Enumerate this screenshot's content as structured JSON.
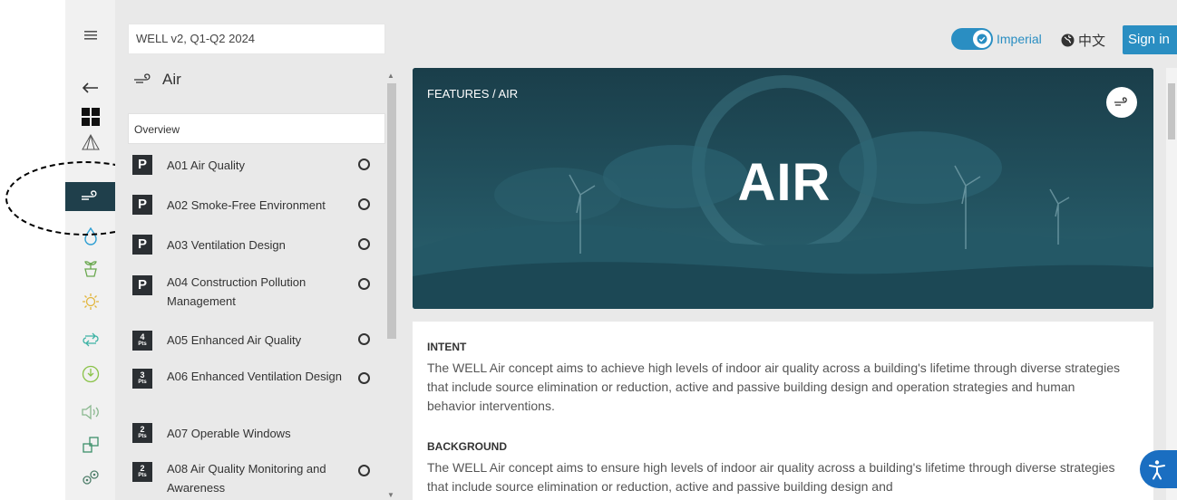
{
  "header": {
    "search_value": "WELL v2, Q1-Q2 2024",
    "units_label": "Imperial",
    "language_label": "中文",
    "sign_in_label": "Sign in"
  },
  "rail": {
    "items": [
      "menu",
      "back",
      "dashboard",
      "concepts",
      "air",
      "water",
      "nourishment",
      "light",
      "movement",
      "thermal-comfort",
      "sound",
      "materials",
      "community"
    ]
  },
  "panel": {
    "title": "Air",
    "overview_label": "Overview",
    "features": [
      {
        "badge": "P",
        "name": "A01 Air Quality"
      },
      {
        "badge": "P",
        "name": "A02 Smoke-Free Environment"
      },
      {
        "badge": "P",
        "name": "A03 Ventilation Design"
      },
      {
        "badge": "P",
        "name": "A04 Construction Pollution Management"
      },
      {
        "badge": "4",
        "badge_unit": "Pts",
        "name": "A05 Enhanced Air Quality"
      },
      {
        "badge": "3",
        "badge_unit": "Pts",
        "name": "A06 Enhanced Ventilation Design"
      },
      {
        "badge": "2",
        "badge_unit": "Pts",
        "name": "A07 Operable Windows"
      },
      {
        "badge": "2",
        "badge_unit": "Pts",
        "name": "A08 Air Quality Monitoring and Awareness"
      }
    ]
  },
  "hero": {
    "breadcrumb": "FEATURES / AIR",
    "title": "AIR"
  },
  "content": {
    "intent_heading": "INTENT",
    "intent_text": "The WELL Air concept aims to achieve high levels of indoor air quality across a building's lifetime through diverse strategies that include source elimination or reduction, active and passive building design and operation strategies and human behavior interventions.",
    "background_heading": "BACKGROUND",
    "background_text": "The WELL Air concept aims to ensure high levels of indoor air quality across a building's lifetime through diverse strategies that include source elimination or reduction, active and passive building design and"
  },
  "colors": {
    "accent": "#2a8ec2",
    "rail_active": "#1f3f4b",
    "badge": "#2b2f33",
    "hero": "#1d4a58",
    "accessibility": "#1a6ec1"
  }
}
